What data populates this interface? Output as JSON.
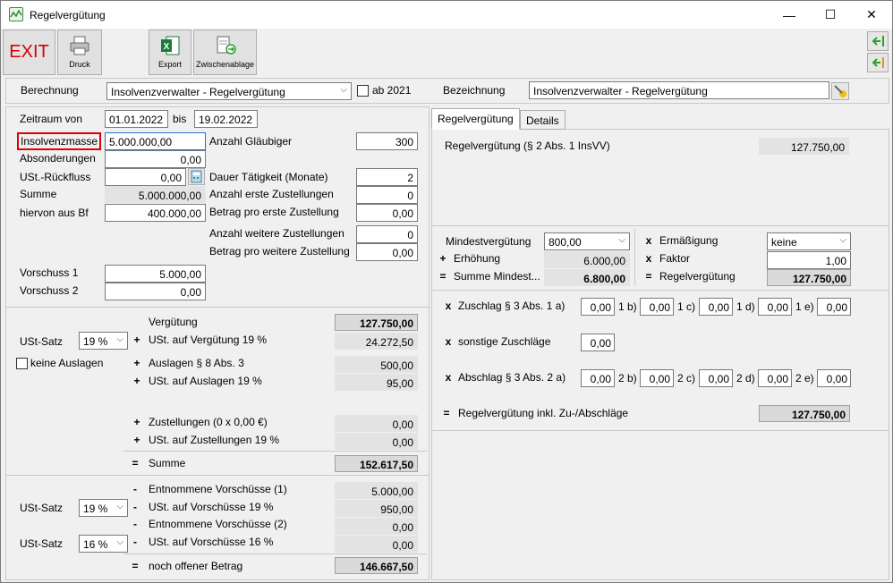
{
  "window": {
    "title": "Regelvergütung",
    "minimize": "—",
    "maximize": "☐",
    "close": "✕"
  },
  "toolbar": {
    "exit": "EXIT",
    "druck": "Druck",
    "export": "Export",
    "zwischenablage": "Zwischenablage"
  },
  "header": {
    "berechnung_label": "Berechnung",
    "berechnung_value": "Insolvenzverwalter - Regelvergütung",
    "ab2021_label": "ab 2021",
    "bezeichnung_label": "Bezeichnung",
    "bezeichnung_value": "Insolvenzverwalter - Regelvergütung"
  },
  "left": {
    "zeitraum_label": "Zeitraum von",
    "zeitraum_von": "01.01.2022",
    "bis_label": "bis",
    "zeitraum_bis": "19.02.2022",
    "insolvenzmasse_label": "Insolvenzmasse",
    "insolvenzmasse_value": "5.000.000,00",
    "absonderungen_label": "Absonderungen",
    "absonderungen_value": "0,00",
    "ust_rueckfluss_label": "USt.-Rückfluss",
    "ust_rueckfluss_value": "0,00",
    "summe_label": "Summe",
    "summe_value": "5.000.000,00",
    "hiervon_label": "hiervon aus Bf",
    "hiervon_value": "400.000,00",
    "glaeubiger_label": "Anzahl Gläubiger",
    "glaeubiger_value": "300",
    "dauer_label": "Dauer Tätigkeit (Monate)",
    "dauer_value": "2",
    "erste_zust_label": "Anzahl erste Zustellungen",
    "erste_zust_value": "0",
    "betrag_erste_label": "Betrag pro erste Zustellung",
    "betrag_erste_value": "0,00",
    "weitere_zust_label": "Anzahl weitere Zustellungen",
    "weitere_zust_value": "0",
    "betrag_weitere_label": "Betrag pro weitere Zustellung",
    "betrag_weitere_value": "0,00",
    "vorschuss1_label": "Vorschuss 1",
    "vorschuss1_value": "5.000,00",
    "vorschuss2_label": "Vorschuss 2",
    "vorschuss2_value": "0,00"
  },
  "calc": {
    "ust_satz_label": "USt-Satz",
    "ust_satz_value": "19 %",
    "keine_auslagen_label": "keine Auslagen",
    "verguetung_label": "Vergütung",
    "verguetung_value": "127.750,00",
    "ust_verguetung_label": "USt. auf Vergütung 19 %",
    "ust_verguetung_value": "24.272,50",
    "auslagen_label": "Auslagen § 8 Abs. 3",
    "auslagen_value": "500,00",
    "ust_auslagen_label": "USt. auf Auslagen 19 %",
    "ust_auslagen_value": "95,00",
    "zustellungen_label": "Zustellungen (0 x 0,00 €)",
    "zustellungen_value": "0,00",
    "ust_zustellungen_label": "USt. auf Zustellungen 19 %",
    "ust_zustellungen_value": "0,00",
    "summe_label": "Summe",
    "summe_value": "152.617,50"
  },
  "vorschuss": {
    "ust_satz1_label": "USt-Satz",
    "ust_satz1_value": "19 %",
    "ust_satz2_label": "USt-Satz",
    "ust_satz2_value": "16 %",
    "entnommen1_label": "Entnommene Vorschüsse (1)",
    "entnommen1_value": "5.000,00",
    "ust_vorschuesse19_label": "USt. auf Vorschüsse 19 %",
    "ust_vorschuesse19_value": "950,00",
    "entnommen2_label": "Entnommene Vorschüsse (2)",
    "entnommen2_value": "0,00",
    "ust_vorschuesse16_label": "USt. auf Vorschüsse 16 %",
    "ust_vorschuesse16_value": "0,00",
    "offen_label": "noch offener Betrag",
    "offen_value": "146.667,50"
  },
  "tabs": {
    "regel": "Regelvergütung",
    "details": "Details"
  },
  "right": {
    "regel_label": "Regelvergütung (§ 2 Abs. 1 InsVV)",
    "regel_value": "127.750,00",
    "mindest_label": "Mindestvergütung",
    "mindest_value": "800,00",
    "erhoehung_label": "Erhöhung",
    "erhoehung_value": "6.000,00",
    "summe_mindest_label": "Summe Mindest...",
    "summe_mindest_value": "6.800,00",
    "ermaessigung_label": "Ermäßigung",
    "ermaessigung_value": "keine",
    "faktor_label": "Faktor",
    "faktor_value": "1,00",
    "regelverg_label": "Regelvergütung",
    "regelverg_value": "127.750,00",
    "zuschlag_label": "Zuschlag § 3 Abs. 1 a)",
    "zuschlag_a": "0,00",
    "zuschlag_b_label": "1 b)",
    "zuschlag_b": "0,00",
    "zuschlag_c_label": "1 c)",
    "zuschlag_c": "0,00",
    "zuschlag_d_label": "1 d)",
    "zuschlag_d": "0,00",
    "zuschlag_e_label": "1 e)",
    "zuschlag_e": "0,00",
    "sonstige_label": "sonstige Zuschläge",
    "sonstige_value": "0,00",
    "abschlag_label": "Abschlag § 3 Abs. 2 a)",
    "abschlag_a": "0,00",
    "abschlag_b_label": "2 b)",
    "abschlag_b": "0,00",
    "abschlag_c_label": "2 c)",
    "abschlag_c": "0,00",
    "abschlag_d_label": "2 d)",
    "abschlag_d": "0,00",
    "abschlag_e_label": "2 e)",
    "abschlag_e": "0,00",
    "inkl_label": "Regelvergütung inkl. Zu-/Abschläge",
    "inkl_value": "127.750,00"
  },
  "ops": {
    "plus": "+",
    "minus": "-",
    "eq": "=",
    "x": "x"
  },
  "colors": {
    "exit_red": "#d80000",
    "highlight_red": "#e00000",
    "excel_green": "#1d7a3c",
    "arrow_green": "#2f9e2f"
  }
}
